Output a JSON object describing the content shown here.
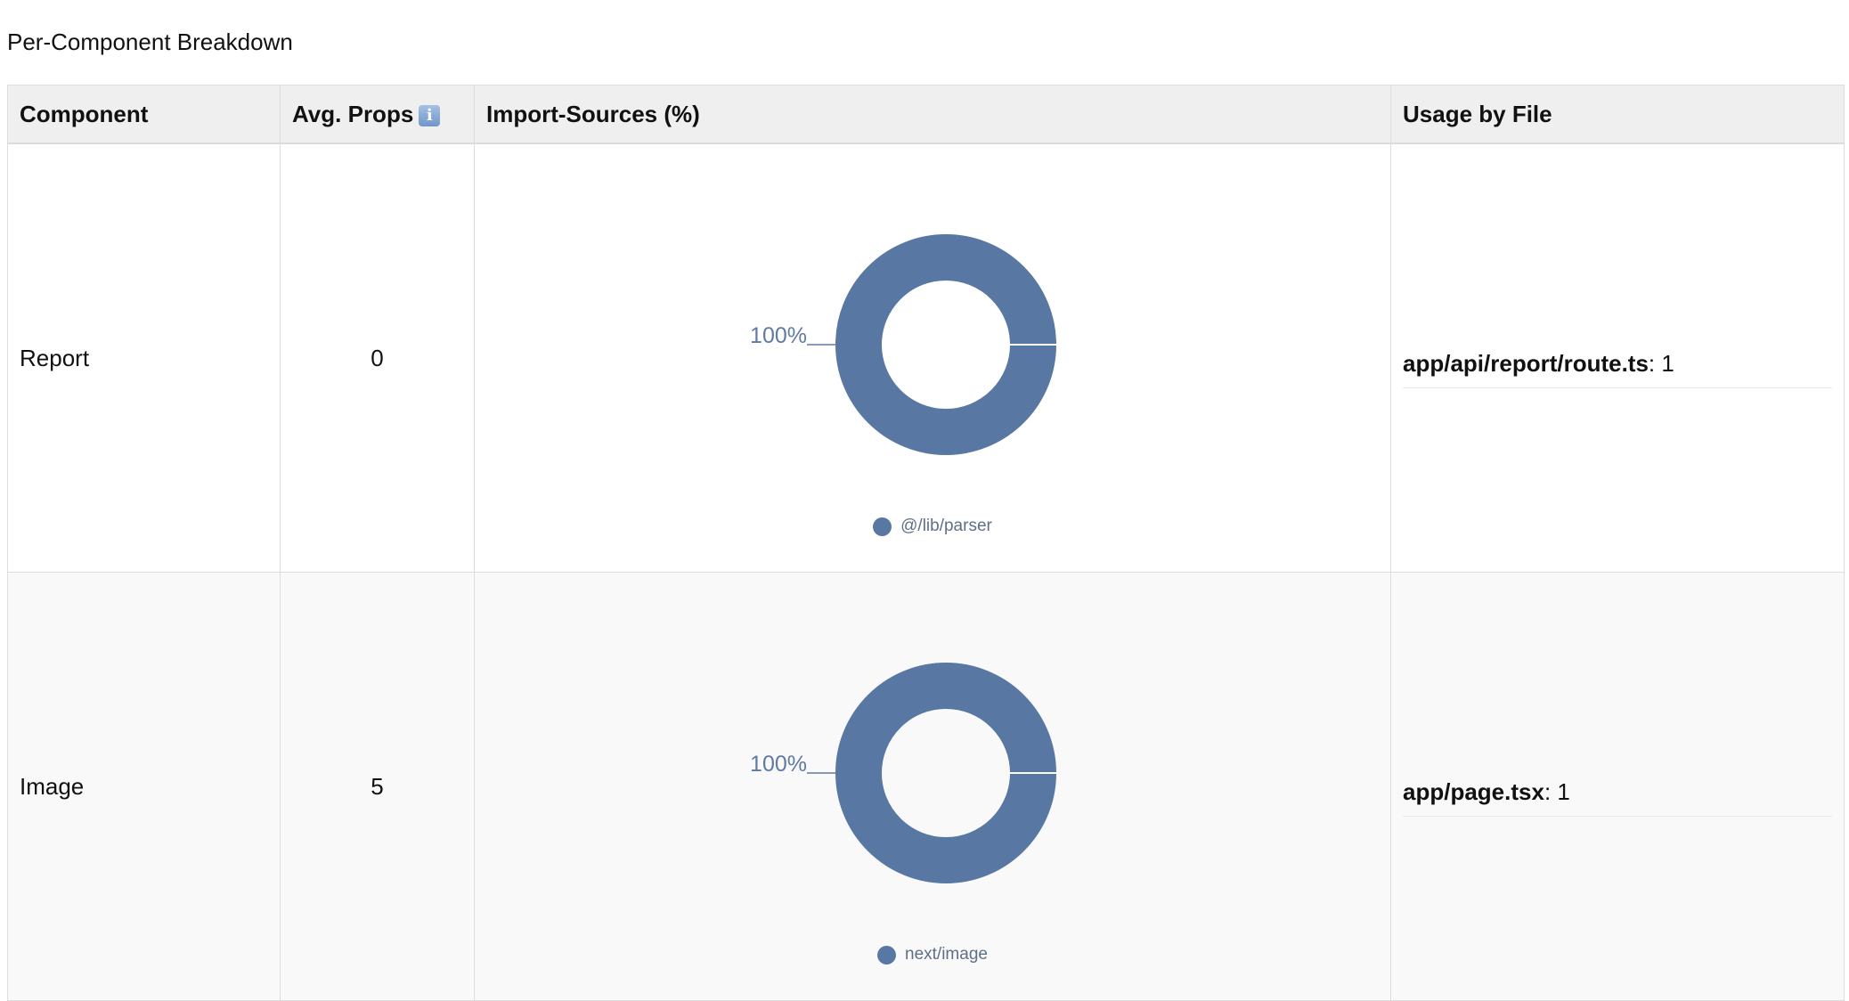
{
  "section_title": "Per-Component Breakdown",
  "table": {
    "headers": {
      "component": "Component",
      "avg_props": "Avg. Props",
      "avg_props_icon": "info-icon",
      "import_sources": "Import-Sources (%)",
      "usage_by_file": "Usage by File"
    },
    "rows": [
      {
        "component": "Report",
        "avg_props": "0",
        "usage": [
          {
            "file": "app/api/report/route.ts",
            "count": ": 1"
          }
        ]
      },
      {
        "component": "Image",
        "avg_props": "5",
        "usage": [
          {
            "file": "app/page.tsx",
            "count": ": 1"
          }
        ]
      }
    ]
  },
  "chart_data": [
    {
      "type": "pie",
      "series": [
        {
          "name": "@/lib/parser",
          "values": [
            100
          ]
        }
      ],
      "categories": [
        "@/lib/parser"
      ],
      "values": [
        100
      ],
      "data_labels": [
        "100%"
      ],
      "legend_placement": "bottom",
      "colors": [
        "#5878a3"
      ]
    },
    {
      "type": "pie",
      "series": [
        {
          "name": "next/image",
          "values": [
            100
          ]
        }
      ],
      "categories": [
        "next/image"
      ],
      "values": [
        100
      ],
      "data_labels": [
        "100%"
      ],
      "legend_placement": "bottom",
      "colors": [
        "#5878a3"
      ]
    }
  ],
  "colors": {
    "slice": "#5878a3",
    "label": "#5f7aa3",
    "header_bg": "#efefef",
    "border": "#dddddd"
  }
}
